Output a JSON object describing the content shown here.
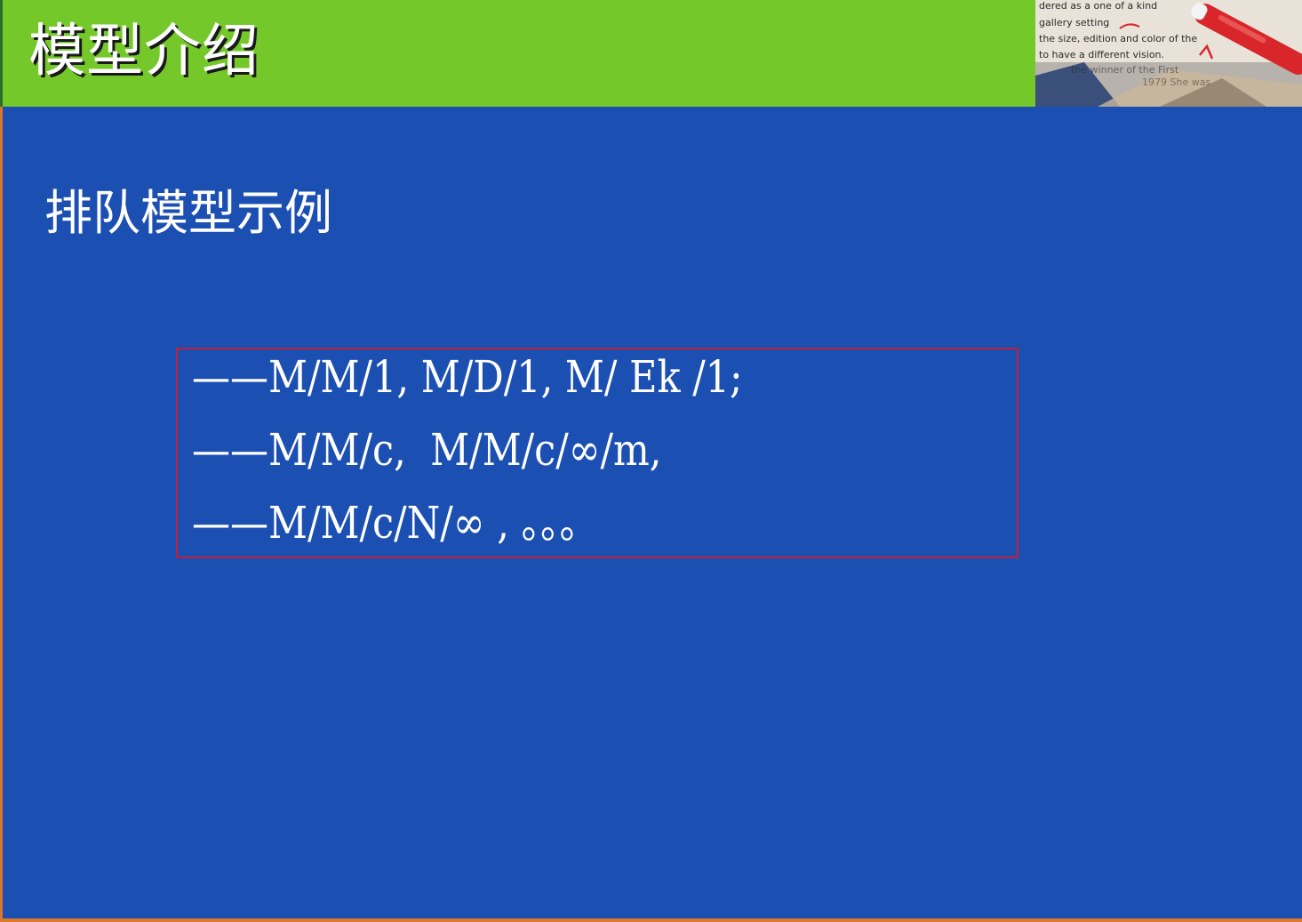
{
  "slide": {
    "title": "模型介绍",
    "subtitle": "排队模型示例",
    "model_lines": [
      "——M/M/1, M/D/1, M/ Ek /1;",
      "——M/M/c,  M/M/c/∞/m,",
      "——M/M/c/N/∞ , 。。。"
    ]
  },
  "corner_image": {
    "text_lines": [
      "dered as  a one of a kind",
      "gallery setting",
      "the size, edition and color of the",
      "to have a different vision.",
      "the winner of the First",
      "1979   She was"
    ]
  },
  "colors": {
    "slide_background": "#1b4fb2",
    "title_bar": "#74c82a",
    "frame_edge": "#d9782e",
    "box_border": "#c0203a",
    "text": "#ffffff"
  }
}
